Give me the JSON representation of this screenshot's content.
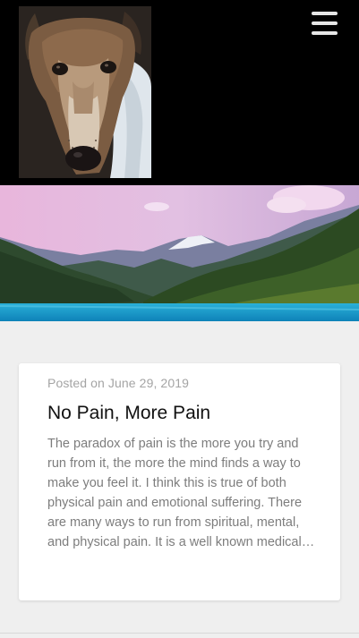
{
  "header": {
    "logo_icon": "dog-photo",
    "menu_icon": "hamburger-menu-icon",
    "background_color": "#000000"
  },
  "hero": {
    "image": "mountain-lake-landscape"
  },
  "post": {
    "date": "Posted on June 29, 2019",
    "title": "No Pain, More Pain",
    "excerpt": "The paradox of pain is the more you try and run from it, the more the mind finds a way to make you feel it. I think this is true of both physical pain and emotional suffering. There are many ways to run from spiritual, mental, and physical pain. It is a well known medical…"
  },
  "colors": {
    "page_background": "#efefef",
    "card_background": "#ffffff",
    "date_text": "#a4a4a4",
    "excerpt_text": "#7d7d7d"
  }
}
